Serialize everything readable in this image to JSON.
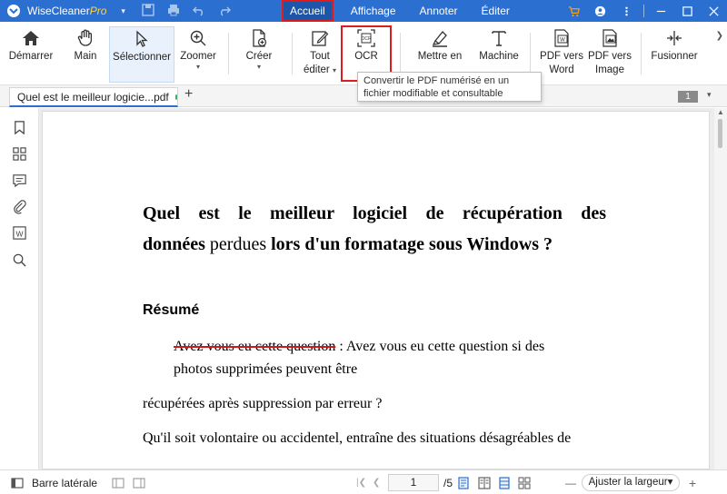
{
  "app": {
    "name": "WiseCleaner",
    "edition": "Pro",
    "dropdown": "▾"
  },
  "menu": [
    "Accueil",
    "Affichage",
    "Annoter",
    "Éditer"
  ],
  "ribbon": {
    "demarrer": "Démarrer",
    "main": "Main",
    "selectionner": "Sélectionner",
    "zoomer": "Zoomer",
    "creer": "Créer",
    "tout_editer": [
      "Tout",
      "éditer"
    ],
    "ocr": "OCR",
    "mettre_en": "Mettre en",
    "machine": "Machine",
    "pdf_word": [
      "PDF vers",
      "Word"
    ],
    "pdf_image": [
      "PDF vers",
      "Image"
    ],
    "fusionner": "Fusionner"
  },
  "tooltip": "Convertir le PDF numérisé en un fichier modifiable et consultable",
  "tab": {
    "title": "Quel est le meilleur logicie...pdf",
    "add": "+"
  },
  "page_badge": "1",
  "document": {
    "title_line1": "Quel est le meilleur logiciel de récupération des",
    "title_line2_a": "données",
    "title_line2_b": "perdues",
    "title_line2_c": "lors d'un formatage sous Windows ?",
    "resume": "Résumé",
    "struck": "Avez vous eu cette question",
    "p1_rest": " :   Avez  vous eu cette question si des",
    "p2": "photos supprimées peuvent être",
    "p3": "récupérées après suppression par erreur ?",
    "p4": "Qu'il soit volontaire ou accidentel, entraîne des situations désagréables de"
  },
  "status": {
    "sidebar_label": "Barre latérale",
    "page_current": "1",
    "page_total": "/5",
    "zoom": "Ajuster la largeur▾",
    "minus": "—",
    "plus": "+"
  },
  "colors": {
    "titlebar": "#2b6fd1",
    "highlight": "#e01b1b",
    "accent": "#2b6fd1"
  }
}
